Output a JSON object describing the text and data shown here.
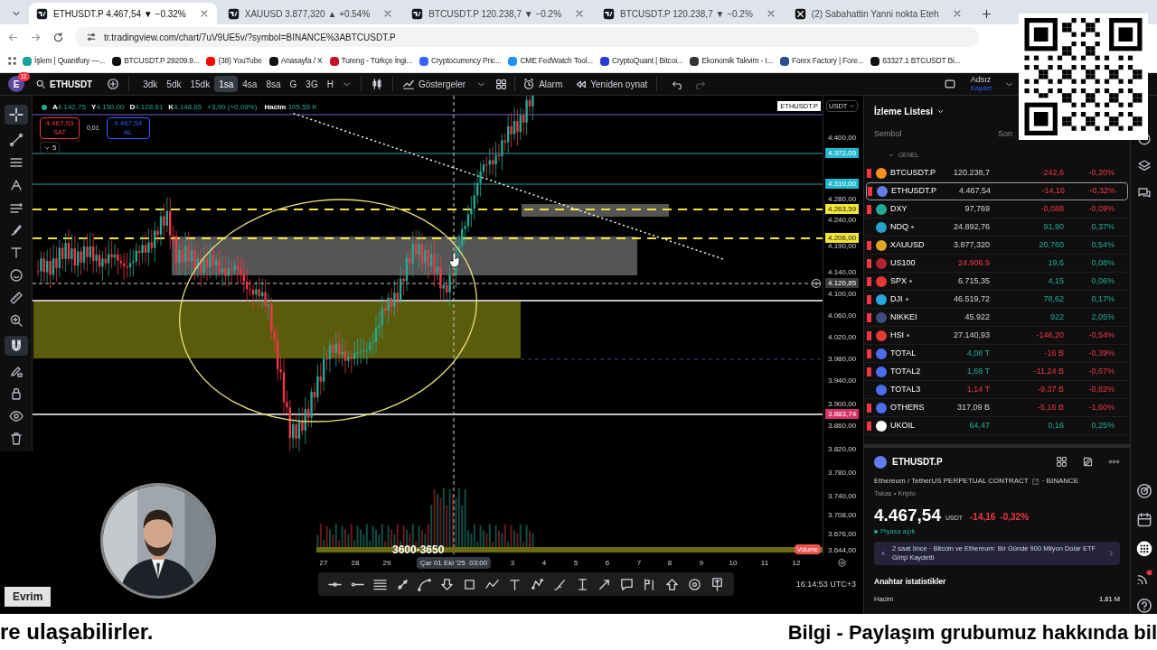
{
  "browser": {
    "tabs": [
      {
        "title": "ETHUSDT.P 4.467,54 ▼ −0.32%",
        "kind": "chart",
        "selected": true
      },
      {
        "title": "XAUUSD 3.877,320 ▲ +0.54%",
        "kind": "chart",
        "selected": false
      },
      {
        "title": "BTCUSDT.P 120.238,7 ▼ −0.2%",
        "kind": "chart",
        "selected": false
      },
      {
        "title": "BTCUSDT.P 120.238,7 ▼ −0.2%",
        "kind": "chart",
        "selected": false
      },
      {
        "title": "(2) Sabahattin Yanni nokta Eteh",
        "kind": "x",
        "selected": false
      }
    ],
    "address": "tr.tradingview.com/chart/7uV9UE5v/?symbol=BINANCE%3ABTCUSDT.P",
    "bookmarks": [
      {
        "label": "İşlem | Quantfury —...",
        "color": "#1aa39a"
      },
      {
        "label": "BTCUSDT.P 29209.9...",
        "color": "#111111"
      },
      {
        "label": "(38) YouTube",
        "color": "#ff0000"
      },
      {
        "label": "Anasayfa / X",
        "color": "#111111"
      },
      {
        "label": "Tureng - Türkçe İngi...",
        "color": "#c8102e"
      },
      {
        "label": "Cryptocurrency Pric...",
        "color": "#3861fb"
      },
      {
        "label": "CME FedWatch Tool...",
        "color": "#1e90ff"
      },
      {
        "label": "CryptoQuant | Bitcoi...",
        "color": "#2b3bd6"
      },
      {
        "label": "Ekonomik Takvim - I...",
        "color": "#333333"
      },
      {
        "label": "Forex Factory | Fore...",
        "color": "#2a4d8f"
      },
      {
        "label": "63327.1 BTCUSDT Bi...",
        "color": "#111111"
      }
    ]
  },
  "toolbar": {
    "avatar": "E",
    "badge": "11",
    "symbol": "ETHUSDT",
    "timeframes": [
      {
        "label": "3dk",
        "selected": false
      },
      {
        "label": "5dk",
        "selected": false
      },
      {
        "label": "15dk",
        "selected": false
      },
      {
        "label": "1sa",
        "selected": true
      },
      {
        "label": "4sa",
        "selected": false
      },
      {
        "label": "8sa",
        "selected": false
      },
      {
        "label": "G",
        "selected": false
      },
      {
        "label": "3G",
        "selected": false
      },
      {
        "label": "H",
        "selected": false
      }
    ],
    "indicators": "Göstergeler",
    "alarm": "Alarm",
    "replay": "Yeniden oynat",
    "layout_name": "Adsız",
    "save": "Kaydet"
  },
  "chart": {
    "legend": [
      {
        "label": "A",
        "value": "4.142,75"
      },
      {
        "label": "Y",
        "value": "4.150,00"
      },
      {
        "label": "D",
        "value": "4.128,61"
      },
      {
        "label": "K",
        "value": "4.148,65"
      }
    ],
    "legend_change": "+3,90 (+0,09%)",
    "volume_label": "Hacim",
    "volume_value": "105,55 K",
    "sell": {
      "price": "4.467,53",
      "label": "SAT"
    },
    "spread": "0,01",
    "buy": {
      "price": "4.467,54",
      "label": "AL"
    },
    "indicator_count": "5",
    "symbol_tag": "ETHUSDT.P",
    "currency": "USDT",
    "axis_labels": [
      "4.400,00",
      "4.280,00",
      "4.240,00",
      "4.190,00",
      "4.140,00",
      "4.100,00",
      "4.060,00",
      "4.020,00",
      "3.980,00",
      "3.940,00",
      "3.900,00",
      "3.860,00",
      "3.820,00",
      "3.780,00",
      "3.740,00",
      "3.708,00",
      "3.676,00",
      "3.644,00"
    ],
    "price_tags": [
      {
        "text": "4.372,05",
        "color": "#22b8cf"
      },
      {
        "text": "4.310,00",
        "color": "#22b8cf"
      },
      {
        "text": "4.263,59",
        "color": "#f2e53a"
      },
      {
        "text": "4.206,00",
        "color": "#f2e53a"
      },
      {
        "text": "4.120,85",
        "color": "#3a3a3a"
      },
      {
        "text": "3.883,74",
        "color": "#d6336c"
      }
    ],
    "annotation": "3600-3650",
    "volume_tag": "Volume",
    "dates": [
      "27",
      "28",
      "29",
      "Çar 01 Eki '25  03:00",
      "3",
      "4",
      "5",
      "6",
      "7",
      "8",
      "9",
      "10",
      "11",
      "12"
    ],
    "clock": "16:14:53 UTC+3"
  },
  "watchlist": {
    "title": "İzleme Listesi",
    "columns": [
      "Sembol",
      "Son"
    ],
    "group": "GENEL",
    "rows": [
      {
        "symbol": "BTCUSDT.P",
        "dot": false,
        "last": "120.238,7",
        "last_rising": false,
        "last_falling": false,
        "change": "-242,6",
        "percent": "-0,20%",
        "falling": true,
        "flagged": true,
        "selected": false,
        "color": "#f7931a"
      },
      {
        "symbol": "ETHUSDT.P",
        "dot": false,
        "last": "4.467,54",
        "last_rising": false,
        "last_falling": false,
        "change": "-14,16",
        "percent": "-0,32%",
        "falling": true,
        "flagged": true,
        "selected": true,
        "color": "#627eea"
      },
      {
        "symbol": "DXY",
        "dot": false,
        "last": "97,769",
        "last_rising": false,
        "last_falling": false,
        "change": "-0,088",
        "percent": "-0,09%",
        "falling": true,
        "flagged": true,
        "selected": false,
        "color": "#22ab94"
      },
      {
        "symbol": "NDQ",
        "dot": true,
        "last": "24.892,76",
        "last_rising": false,
        "last_falling": false,
        "change": "91,90",
        "percent": "0,37%",
        "falling": false,
        "flagged": false,
        "selected": false,
        "color": "#26a3c9"
      },
      {
        "symbol": "XAUUSD",
        "dot": false,
        "last": "3.877,320",
        "last_rising": false,
        "last_falling": false,
        "change": "20,760",
        "percent": "0,54%",
        "falling": false,
        "flagged": true,
        "selected": false,
        "color": "#e0a526"
      },
      {
        "symbol": "US100",
        "dot": false,
        "last": "24.906,9",
        "last_rising": false,
        "last_falling": true,
        "change": "19,6",
        "percent": "0,08%",
        "falling": false,
        "flagged": true,
        "selected": false,
        "color": "#b22234"
      },
      {
        "symbol": "SPX",
        "dot": true,
        "last": "6.715,35",
        "last_rising": false,
        "last_falling": false,
        "change": "4,15",
        "percent": "0,06%",
        "falling": false,
        "flagged": true,
        "selected": false,
        "color": "#e53935"
      },
      {
        "symbol": "DJI",
        "dot": true,
        "last": "46.519,72",
        "last_rising": false,
        "last_falling": false,
        "change": "78,62",
        "percent": "0,17%",
        "falling": false,
        "flagged": true,
        "selected": false,
        "color": "#29a8e0"
      },
      {
        "symbol": "NIKKEI",
        "dot": false,
        "last": "45.922",
        "last_rising": false,
        "last_falling": false,
        "change": "922",
        "percent": "2,05%",
        "falling": false,
        "flagged": true,
        "selected": false,
        "color": "#3f4d80"
      },
      {
        "symbol": "HSI",
        "dot": true,
        "last": "27.140,93",
        "last_rising": false,
        "last_falling": false,
        "change": "-146,20",
        "percent": "-0,54%",
        "falling": true,
        "flagged": true,
        "selected": false,
        "color": "#e53935"
      },
      {
        "symbol": "TOTAL",
        "dot": false,
        "last": "4,08 T",
        "last_rising": true,
        "last_falling": false,
        "change": "-16 B",
        "percent": "-0,39%",
        "falling": true,
        "flagged": true,
        "selected": false,
        "color": "#4e6cf0"
      },
      {
        "symbol": "TOTAL2",
        "dot": false,
        "last": "1,68 T",
        "last_rising": true,
        "last_falling": false,
        "change": "-11,24 B",
        "percent": "-0,67%",
        "falling": true,
        "flagged": true,
        "selected": false,
        "color": "#4e6cf0"
      },
      {
        "symbol": "TOTAL3",
        "dot": false,
        "last": "1,14 T",
        "last_rising": false,
        "last_falling": true,
        "change": "-9,37 B",
        "percent": "-0,82%",
        "falling": true,
        "flagged": false,
        "selected": false,
        "color": "#4e6cf0"
      },
      {
        "symbol": "OTHERS",
        "dot": false,
        "last": "317,09 B",
        "last_rising": false,
        "last_falling": false,
        "change": "-5,16 B",
        "percent": "-1,60%",
        "falling": true,
        "flagged": true,
        "selected": false,
        "color": "#4e6cf0"
      },
      {
        "symbol": "UKOIL",
        "dot": false,
        "last": "64,47",
        "last_rising": true,
        "last_falling": false,
        "change": "0,16",
        "percent": "0,25%",
        "falling": false,
        "flagged": true,
        "selected": false,
        "color": "#ffffff"
      }
    ]
  },
  "details": {
    "symbol": "ETHUSDT.P",
    "description": "Ethereum / TetherUS PERPETUAL CONTRACT",
    "exchange": "· BINANCE",
    "category": "Takas • Kripto",
    "price": "4.467,54",
    "currency": "USDT",
    "change": "-14,16",
    "percent": "-0,32%",
    "market_status": "Piyasa açık",
    "news": "2 saat önce · Bitcoin ve Ethereum: Bir Günde 900 Milyon Dolar ETF Girişi Kaydetti",
    "stats_title": "Anahtar istatistikler",
    "stats": [
      {
        "label": "Hacim",
        "value": "1,81 M"
      }
    ]
  },
  "webcam": {
    "kind": "picture",
    "name": "Evrim"
  },
  "ticker": [
    "re ulaşabilirler.",
    "Bilgi - Paylaşım grubumuz hakkında bil"
  ]
}
